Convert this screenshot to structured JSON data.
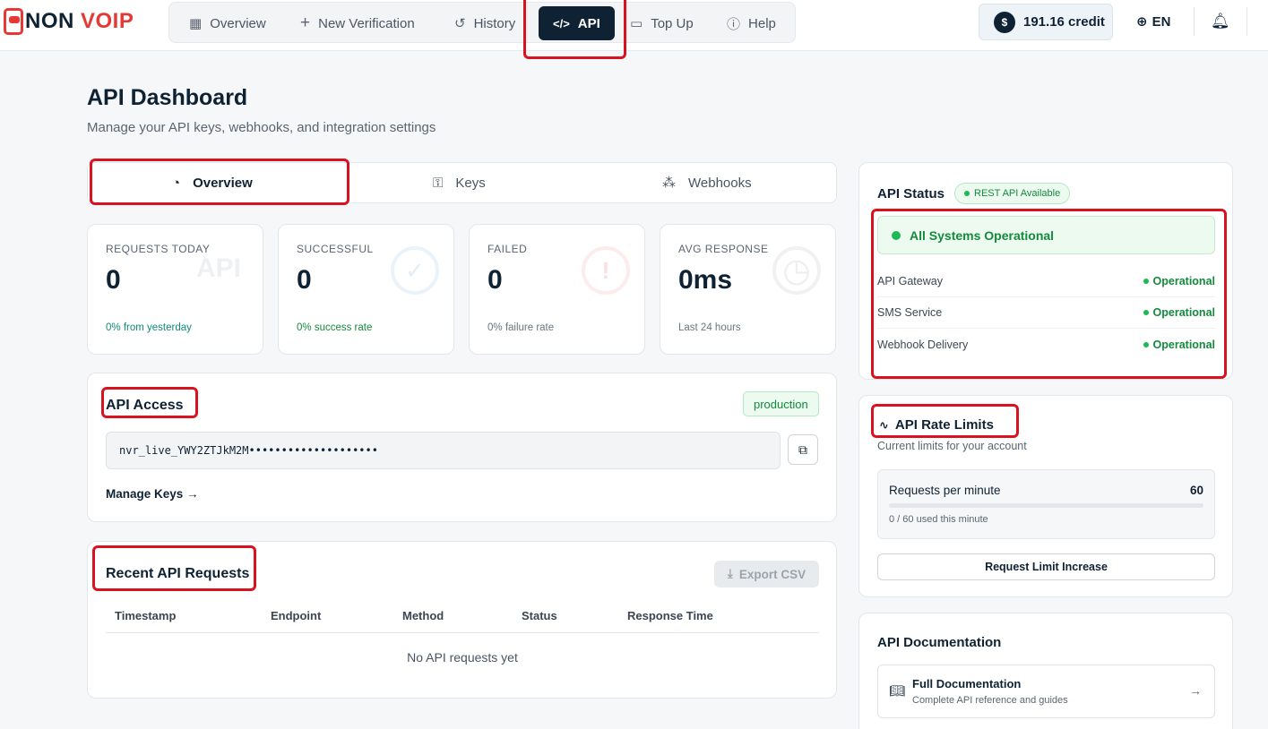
{
  "brand": {
    "name_dark": "NON ",
    "name_red": "VOIP"
  },
  "nav": [
    {
      "label": "Overview",
      "icon": "grid-icon"
    },
    {
      "label": "New Verification",
      "icon": "plus-icon"
    },
    {
      "label": "History",
      "icon": "history-icon"
    },
    {
      "label": "API",
      "icon": "code-icon",
      "active": true
    },
    {
      "label": "Top Up",
      "icon": "wallet-icon"
    },
    {
      "label": "Help",
      "icon": "help-icon"
    }
  ],
  "credit": {
    "symbol": "$",
    "label": "191.16 credit"
  },
  "language": "EN",
  "page": {
    "title": "API Dashboard",
    "subtitle": "Manage your API keys, webhooks, and integration settings"
  },
  "tabs": [
    {
      "label": "Overview",
      "icon": "gauge-icon",
      "active": true
    },
    {
      "label": "Keys",
      "icon": "key-icon"
    },
    {
      "label": "Webhooks",
      "icon": "webhook-icon"
    }
  ],
  "stats": [
    {
      "label": "REQUESTS TODAY",
      "value": "0",
      "footer": "0% from yesterday",
      "footer_color": "#0e8a7a",
      "watermark": "API"
    },
    {
      "label": "SUCCESSFUL",
      "value": "0",
      "footer": "0% success rate",
      "footer_color": "#148a3c",
      "watermark": "✓"
    },
    {
      "label": "FAILED",
      "value": "0",
      "footer": "0% failure rate",
      "footer_color": "#6b7580",
      "watermark": "!"
    },
    {
      "label": "AVG RESPONSE",
      "value": "0ms",
      "footer": "Last 24 hours",
      "footer_color": "#6b7580",
      "watermark": "◷"
    }
  ],
  "api_access": {
    "title": "API Access",
    "environment": "production",
    "key": "nvr_live_YWY2ZTJkM2M••••••••••••••••••••",
    "manage_link": "Manage Keys →"
  },
  "recent": {
    "title": "Recent API Requests",
    "export_label": "Export CSV",
    "columns": [
      "Timestamp",
      "Endpoint",
      "Method",
      "Status",
      "Response Time"
    ],
    "empty": "No API requests yet"
  },
  "status": {
    "title": "API Status",
    "badge": "REST API Available",
    "overall": "All Systems Operational",
    "services": [
      {
        "name": "API Gateway",
        "state": "Operational"
      },
      {
        "name": "SMS Service",
        "state": "Operational"
      },
      {
        "name": "Webhook Delivery",
        "state": "Operational"
      }
    ]
  },
  "rate_limits": {
    "title": "API Rate Limits",
    "subtitle": "Current limits for your account",
    "label": "Requests per minute",
    "limit": "60",
    "usage": "0 / 60 used this minute",
    "used_fraction": 0,
    "button": "Request Limit Increase"
  },
  "docs": {
    "title": "API Documentation",
    "items": [
      {
        "title": "Full Documentation",
        "subtitle": "Complete API reference and guides"
      }
    ]
  }
}
